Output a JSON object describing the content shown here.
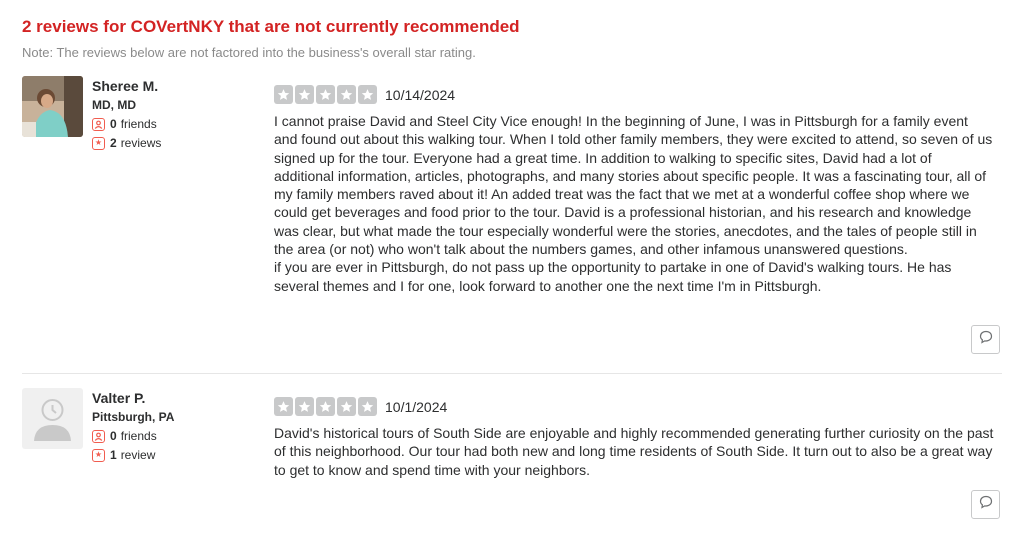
{
  "header": {
    "title": "2 reviews for COVertNKY that are not currently recommended",
    "note": "Note: The reviews below are not factored into the business's overall star rating."
  },
  "reviews": [
    {
      "user": {
        "name": "Sheree M.",
        "location": "MD, MD",
        "friends_count": "0",
        "friends_label": "friends",
        "reviews_count": "2",
        "reviews_label": "reviews"
      },
      "rating": 5,
      "date": "10/14/2024",
      "text": "I cannot praise David and Steel City Vice enough! In the beginning of June, I was in Pittsburgh for a family event and found out about this walking tour. When I told other family members, they were excited to attend, so seven of us signed up for the tour. Everyone had a great time. In addition to walking to specific sites, David had a lot of additional information, articles, photographs, and many stories about specific people. It was a fascinating tour,  all of my family members raved about it! An added treat was the fact that we met at a wonderful coffee shop where we could get beverages and food prior to the tour. David is a professional historian, and his research and knowledge was clear, but what made the tour especially wonderful were the stories,  anecdotes, and the tales of people still in the area (or not) who won't talk about the numbers games,  and other infamous unanswered questions.\nif you are ever in Pittsburgh, do not pass up the opportunity to partake in one of David's walking tours. He has several themes and I for one, look forward to another one the next time I'm in Pittsburgh."
    },
    {
      "user": {
        "name": "Valter P.",
        "location": "Pittsburgh, PA",
        "friends_count": "0",
        "friends_label": "friends",
        "reviews_count": "1",
        "reviews_label": "review"
      },
      "rating": 5,
      "date": "10/1/2024",
      "text": "David's historical tours of South Side are enjoyable and highly recommended generating further curiosity on the past of this neighborhood. Our tour had both new and long time residents of South Side. It turn out to also be a great way to get to know and spend time with your neighbors."
    }
  ],
  "colors": {
    "title": "#d32323",
    "star_empty": "#c8c9ca",
    "stat_icon": "#f15c4f"
  },
  "icons": {
    "friends": "friends-icon",
    "reviews": "review-count-star-icon",
    "comment": "speech-bubble-icon",
    "default_avatar": "default-user-icon"
  }
}
